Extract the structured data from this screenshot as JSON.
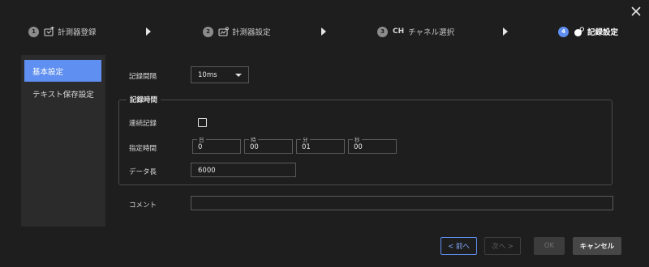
{
  "close_icon": "close-icon",
  "steps": [
    {
      "num": "1",
      "label": "計測器登録",
      "icon": "device-register-icon",
      "active": false
    },
    {
      "num": "2",
      "label": "計測器設定",
      "icon": "device-settings-icon",
      "active": false
    },
    {
      "num": "3",
      "ch": "CH",
      "label": "チャネル選択",
      "active": false
    },
    {
      "num": "4",
      "label": "記録設定",
      "icon": "record-settings-icon",
      "active": true
    }
  ],
  "sidebar": {
    "items": [
      {
        "label": "基本設定",
        "active": true
      },
      {
        "label": "テキスト保存設定",
        "active": false
      }
    ]
  },
  "form": {
    "interval_label": "記録間隔",
    "interval_value": "10ms",
    "record_time_legend": "記録時間",
    "continuous_label": "連続記録",
    "continuous_checked": false,
    "specified_time_label": "指定時間",
    "time_fields": [
      {
        "caption": "日",
        "value": "0"
      },
      {
        "caption": "時",
        "value": "00"
      },
      {
        "caption": "分",
        "value": "01"
      },
      {
        "caption": "秒",
        "value": "00"
      }
    ],
    "data_length_label": "データ長",
    "data_length_value": "6000",
    "comment_label": "コメント",
    "comment_value": ""
  },
  "footer": {
    "prev_label": "< 前へ",
    "next_label": "次へ >",
    "ok_label": "OK",
    "cancel_label": "キャンセル"
  },
  "colors": {
    "accent": "#5f8ff0",
    "background": "#1e1e1f",
    "sidebar": "#2b2b2c"
  }
}
